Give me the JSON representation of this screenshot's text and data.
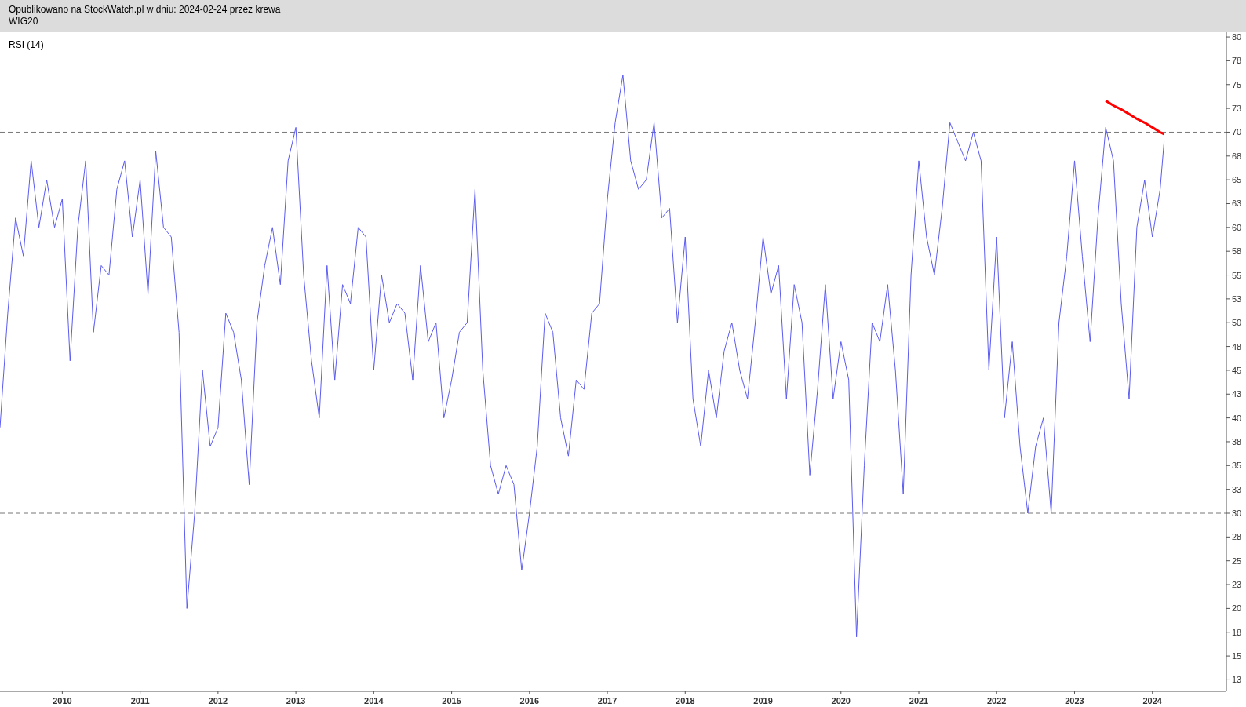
{
  "header": {
    "line_1": "Opublikowano na StockWatch.pl w dniu: 2024-02-24 przez krewa",
    "line_2": "WIG20"
  },
  "chart": {
    "chart_data": {
      "type": "line",
      "title": "RSI (14)",
      "x": [
        2009.2,
        2009.3,
        2009.4,
        2009.5,
        2009.6,
        2009.7,
        2009.8,
        2009.9,
        2010.0,
        2010.1,
        2010.2,
        2010.3,
        2010.4,
        2010.5,
        2010.6,
        2010.7,
        2010.8,
        2010.9,
        2011.0,
        2011.1,
        2011.2,
        2011.3,
        2011.4,
        2011.5,
        2011.6,
        2011.7,
        2011.8,
        2011.9,
        2012.0,
        2012.1,
        2012.2,
        2012.3,
        2012.4,
        2012.5,
        2012.6,
        2012.7,
        2012.8,
        2012.9,
        2013.0,
        2013.1,
        2013.2,
        2013.3,
        2013.4,
        2013.5,
        2013.6,
        2013.7,
        2013.8,
        2013.9,
        2014.0,
        2014.1,
        2014.2,
        2014.3,
        2014.4,
        2014.5,
        2014.6,
        2014.7,
        2014.8,
        2014.9,
        2015.0,
        2015.1,
        2015.2,
        2015.3,
        2015.4,
        2015.5,
        2015.6,
        2015.7,
        2015.8,
        2015.9,
        2016.0,
        2016.1,
        2016.2,
        2016.3,
        2016.4,
        2016.5,
        2016.6,
        2016.7,
        2016.8,
        2016.9,
        2017.0,
        2017.1,
        2017.2,
        2017.3,
        2017.4,
        2017.5,
        2017.6,
        2017.7,
        2017.8,
        2017.9,
        2018.0,
        2018.1,
        2018.2,
        2018.3,
        2018.4,
        2018.5,
        2018.6,
        2018.7,
        2018.8,
        2018.9,
        2019.0,
        2019.1,
        2019.2,
        2019.3,
        2019.4,
        2019.5,
        2019.6,
        2019.7,
        2019.8,
        2019.9,
        2020.0,
        2020.1,
        2020.2,
        2020.3,
        2020.4,
        2020.5,
        2020.6,
        2020.7,
        2020.8,
        2020.9,
        2021.0,
        2021.1,
        2021.2,
        2021.3,
        2021.4,
        2021.5,
        2021.6,
        2021.7,
        2021.8,
        2021.9,
        2022.0,
        2022.1,
        2022.2,
        2022.3,
        2022.4,
        2022.5,
        2022.6,
        2022.7,
        2022.8,
        2022.9,
        2023.0,
        2023.1,
        2023.2,
        2023.3,
        2023.4,
        2023.5,
        2023.6,
        2023.7,
        2023.8,
        2023.9,
        2024.0,
        2024.1,
        2024.15
      ],
      "series": [
        {
          "color": "#5b5bf0",
          "values": [
            39,
            51,
            61,
            57,
            67,
            60,
            65,
            60,
            63,
            46,
            60,
            67,
            49,
            56,
            55,
            64,
            67,
            59,
            65,
            53,
            68,
            60,
            59,
            49,
            20,
            30,
            45,
            37,
            39,
            51,
            49,
            44,
            33,
            50,
            56,
            60,
            54,
            67,
            70.5,
            55,
            46,
            40,
            56,
            44,
            54,
            52,
            60,
            59,
            45,
            55,
            50,
            52,
            51,
            44,
            56,
            48,
            50,
            40,
            44,
            49,
            50,
            64,
            45,
            35,
            32,
            35,
            33,
            24,
            30,
            37,
            51,
            49,
            40,
            36,
            44,
            43,
            51,
            52,
            63,
            71,
            76,
            67,
            64,
            65,
            71,
            61,
            62,
            50,
            59,
            42,
            37,
            45,
            40,
            47,
            50,
            45,
            42,
            50,
            59,
            53,
            56,
            42,
            54,
            50,
            34,
            43,
            54,
            42,
            48,
            44,
            17,
            35,
            50,
            48,
            54,
            45,
            32,
            55,
            67,
            59,
            55,
            62,
            71,
            69,
            67,
            70,
            67,
            45,
            59,
            40,
            48,
            37,
            30,
            37,
            40,
            30,
            50,
            57,
            67,
            57,
            48,
            61,
            70.5,
            67,
            52,
            42,
            60,
            65,
            59,
            64,
            69
          ]
        },
        {
          "color": "#ff0000",
          "values": [
            null,
            null,
            null,
            null,
            null,
            null,
            null,
            null,
            null,
            null,
            null,
            null,
            null,
            null,
            null,
            null,
            null,
            null,
            null,
            null,
            null,
            null,
            null,
            null,
            null,
            null,
            null,
            null,
            null,
            null,
            null,
            null,
            null,
            null,
            null,
            null,
            null,
            null,
            null,
            null,
            null,
            null,
            null,
            null,
            null,
            null,
            null,
            null,
            null,
            null,
            null,
            null,
            null,
            null,
            null,
            null,
            null,
            null,
            null,
            null,
            null,
            null,
            null,
            null,
            null,
            null,
            null,
            null,
            null,
            null,
            null,
            null,
            null,
            null,
            null,
            null,
            null,
            null,
            null,
            null,
            null,
            null,
            null,
            null,
            null,
            null,
            null,
            null,
            null,
            null,
            null,
            null,
            null,
            null,
            null,
            null,
            null,
            null,
            null,
            null,
            null,
            null,
            null,
            null,
            null,
            null,
            null,
            null,
            null,
            null,
            null,
            null,
            null,
            null,
            null,
            null,
            null,
            null,
            null,
            null,
            null,
            null,
            null,
            null,
            null,
            null,
            null,
            null,
            null,
            null,
            null,
            null,
            null,
            null,
            null,
            null,
            null,
            null,
            null,
            null,
            null,
            null,
            73.3,
            72.8,
            72.4,
            71.9,
            71.4,
            71,
            70.5,
            70,
            69.8
          ]
        }
      ],
      "xlim": [
        2009.2,
        2024.95
      ],
      "ylim": [
        11.3,
        80.5
      ],
      "xticks": [
        {
          "value": 2010,
          "label": "2010"
        },
        {
          "value": 2011,
          "label": "2011"
        },
        {
          "value": 2012,
          "label": "2012"
        },
        {
          "value": 2013,
          "label": "2013"
        },
        {
          "value": 2014,
          "label": "2014"
        },
        {
          "value": 2015,
          "label": "2015"
        },
        {
          "value": 2016,
          "label": "2016"
        },
        {
          "value": 2017,
          "label": "2017"
        },
        {
          "value": 2018,
          "label": "2018"
        },
        {
          "value": 2019,
          "label": "2019"
        },
        {
          "value": 2020,
          "label": "2020"
        },
        {
          "value": 2021,
          "label": "2021"
        },
        {
          "value": 2022,
          "label": "2022"
        },
        {
          "value": 2023,
          "label": "2023"
        },
        {
          "value": 2024,
          "label": "2024"
        }
      ],
      "yticks": [
        {
          "value": 12.5,
          "label": "13"
        },
        {
          "value": 15,
          "label": "15"
        },
        {
          "value": 17.5,
          "label": "18"
        },
        {
          "value": 20,
          "label": "20"
        },
        {
          "value": 22.5,
          "label": "23"
        },
        {
          "value": 25,
          "label": "25"
        },
        {
          "value": 27.5,
          "label": "28"
        },
        {
          "value": 30,
          "label": "30"
        },
        {
          "value": 32.5,
          "label": "33"
        },
        {
          "value": 35,
          "label": "35"
        },
        {
          "value": 37.5,
          "label": "38"
        },
        {
          "value": 40,
          "label": "40"
        },
        {
          "value": 42.5,
          "label": "43"
        },
        {
          "value": 45,
          "label": "45"
        },
        {
          "value": 47.5,
          "label": "48"
        },
        {
          "value": 50,
          "label": "50"
        },
        {
          "value": 52.5,
          "label": "53"
        },
        {
          "value": 55,
          "label": "55"
        },
        {
          "value": 57.5,
          "label": "58"
        },
        {
          "value": 60,
          "label": "60"
        },
        {
          "value": 62.5,
          "label": "63"
        },
        {
          "value": 65,
          "label": "65"
        },
        {
          "value": 67.5,
          "label": "68"
        },
        {
          "value": 70,
          "label": "70"
        },
        {
          "value": 72.5,
          "label": "73"
        },
        {
          "value": 75,
          "label": "75"
        },
        {
          "value": 77.5,
          "label": "78"
        },
        {
          "value": 80,
          "label": "80"
        }
      ],
      "ref_lines": [
        {
          "axis": "y",
          "value": 70
        },
        {
          "axis": "y",
          "value": 30
        }
      ]
    }
  }
}
